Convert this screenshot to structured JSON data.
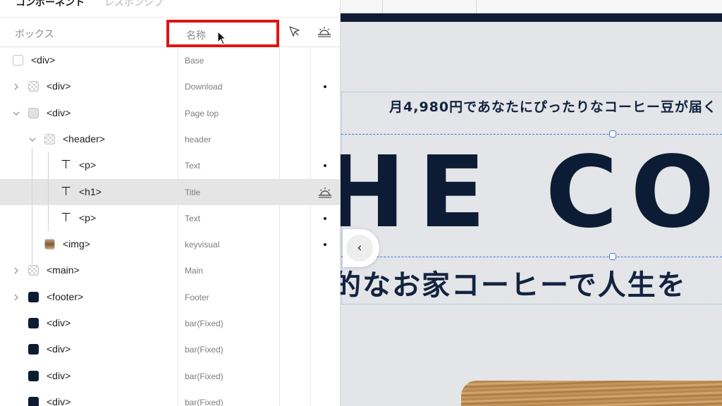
{
  "panel": {
    "tabs": {
      "components": "コンポーネント",
      "responsive": "レスポンシブ"
    },
    "header": {
      "box_label": "ボックス",
      "name_placeholder": "名称"
    },
    "rows": [
      {
        "tag": "<div>",
        "name": "Base",
        "icon": "empty-square-icon",
        "depth": 0,
        "chevron": "none"
      },
      {
        "tag": "<div>",
        "name": "Download",
        "icon": "checker-square-icon",
        "depth": 0,
        "chevron": "right",
        "dot": true
      },
      {
        "tag": "<div>",
        "name": "Page top",
        "icon": "gray-square-icon",
        "depth": 0,
        "chevron": "down"
      },
      {
        "tag": "<header>",
        "name": "header",
        "icon": "checker-square-icon",
        "depth": 1,
        "chevron": "down"
      },
      {
        "tag": "<p>",
        "name": "Text",
        "icon": "text-icon",
        "depth": 2,
        "chevron": "none",
        "dot": true
      },
      {
        "tag": "<h1>",
        "name": "Title",
        "icon": "text-icon",
        "depth": 2,
        "chevron": "none",
        "selected": true,
        "badge": "sun-icon"
      },
      {
        "tag": "<p>",
        "name": "Text",
        "icon": "text-icon",
        "depth": 2,
        "chevron": "none",
        "dot": true
      },
      {
        "tag": "<img>",
        "name": "keyvisual",
        "icon": "image-icon",
        "depth": 1,
        "chevron": "none",
        "dot": true
      },
      {
        "tag": "<main>",
        "name": "Main",
        "icon": "checker-square-icon",
        "depth": 0,
        "chevron": "right"
      },
      {
        "tag": "<footer>",
        "name": "Footer",
        "icon": "navy-square-icon",
        "depth": 0,
        "chevron": "right"
      },
      {
        "tag": "<div>",
        "name": "bar(Fixed)",
        "icon": "navy-square-icon",
        "depth": 0,
        "chevron": "none"
      },
      {
        "tag": "<div>",
        "name": "bar(Fixed)",
        "icon": "navy-square-icon",
        "depth": 0,
        "chevron": "none"
      },
      {
        "tag": "<div>",
        "name": "bar(Fixed)",
        "icon": "navy-square-icon",
        "depth": 0,
        "chevron": "none"
      },
      {
        "tag": "<div>",
        "name": "bar(Fixed)",
        "icon": "navy-square-icon",
        "depth": 0,
        "chevron": "none"
      }
    ]
  },
  "canvas": {
    "tagline": "月4,980円であなたにぴったりなコーヒー豆が届く",
    "title": "HE COF",
    "subtitle": "的なお家コーヒーで人生を"
  },
  "colors": {
    "navy": "#0e1c33",
    "highlight_red": "#e11414",
    "selection_blue": "#3d7be0",
    "selected_row": "#e5e5e5"
  }
}
